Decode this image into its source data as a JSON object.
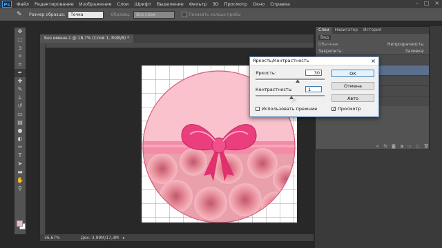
{
  "app": {
    "logo": "Ps"
  },
  "menu": [
    "Файл",
    "Редактирование",
    "Изображение",
    "Слои",
    "Шрифт",
    "Выделение",
    "Фильтр",
    "3D",
    "Просмотр",
    "Окно",
    "Справка"
  ],
  "options_bar": {
    "sample_size_label": "Размер образца:",
    "sample_size_value": "Точка",
    "sample_label": "Образец:",
    "sample_value": "Все слои",
    "show_ring_label": "Показать кольцо пробы"
  },
  "document": {
    "tab_title": "Без имени-1 @ 18,7% (Слой 1, RGB/8) *",
    "zoom": "36,67%",
    "doc_size": "Док: 3,99M/17,3M"
  },
  "layers_panel": {
    "tabs": [
      "Слои",
      "Навигатор",
      "История"
    ],
    "kind_label": "Вид",
    "blend_mode": "Обычные",
    "opacity_label": "Непрозрачность:",
    "lock_label": "Закрепить:",
    "fill_label": "Заливка:"
  },
  "dialog": {
    "title": "Яркость/Контрастность",
    "brightness_label": "Яркость:",
    "brightness_value": "30",
    "contrast_label": "Контрастность:",
    "contrast_value": "1",
    "ok_label": "ОК",
    "cancel_label": "Отмена",
    "auto_label": "Авто",
    "use_legacy_label": "Использовать прежние",
    "use_legacy_checked": false,
    "preview_label": "Просмотр",
    "preview_checked": true
  },
  "colors": {
    "foreground": "#f3b9c9",
    "background": "#ffffff",
    "accent": "#3c7fb1"
  }
}
